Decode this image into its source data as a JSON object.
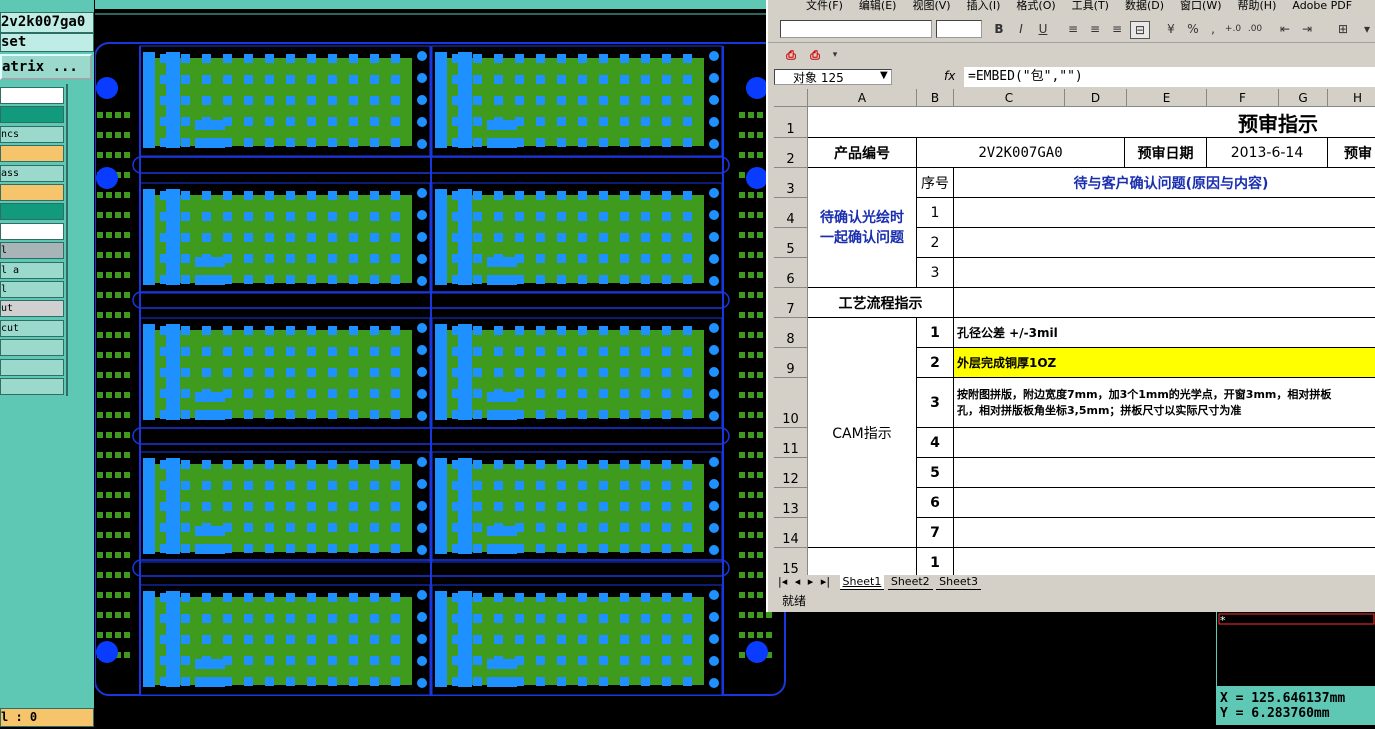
{
  "cam": {
    "job_name": "2v2k007ga0",
    "step_name": "set",
    "matrix_button": "atrix ...",
    "layers": [
      "",
      "",
      "ncs",
      "",
      "ass",
      "",
      "",
      "",
      "l",
      "l a",
      "l",
      "ut",
      "cut",
      "",
      "",
      ""
    ],
    "layer_colors": [
      "#ffffff",
      "#119a7c",
      "#9ad9cc",
      "#f6c46a",
      "#9ad9cc",
      "#f6c46a",
      "#119a7c",
      "#ffffff",
      "#a8b4b8",
      "#9ad9cc",
      "#9ad9cc",
      "#d0d0d0",
      "#9ad9cc",
      "#9ad9cc",
      "#9ad9cc",
      "#9ad9cc"
    ],
    "footer": "l : 0",
    "coord_x": "X = 125.646137mm",
    "coord_y": "Y = 6.283760mm",
    "board_colors": {
      "copper": "#3e9b1e",
      "pad": "#1e90ff",
      "outline": "#1a36e0",
      "hole": "#0a3cff"
    }
  },
  "excel": {
    "menus": [
      "文件(F)",
      "编辑(E)",
      "视图(V)",
      "插入(I)",
      "格式(O)",
      "工具(T)",
      "数据(D)",
      "窗口(W)",
      "帮助(H)",
      "Adobe PDF"
    ],
    "name_box": "对象 125",
    "fx": "fx",
    "formula": "=EMBED(\"包\",\"\")",
    "columns": [
      "A",
      "B",
      "C",
      "D",
      "E",
      "F",
      "G",
      "H"
    ],
    "rows": [
      "1",
      "2",
      "3",
      "4",
      "5",
      "6",
      "7",
      "8",
      "9",
      "10",
      "11",
      "12",
      "13",
      "14",
      "15"
    ],
    "title": "预审指示",
    "product_label": "产品编号",
    "product_value": "2V2K007GA0",
    "date_label": "预审日期",
    "date_value": "2013-6-14",
    "h2_extra": "预审",
    "seq_label": "序号",
    "confirm_header": "待与客户确认问题(原因与内容)",
    "pending_label_1": "待确认光绘时",
    "pending_label_2": "一起确认问题",
    "process_label": "工艺流程指示",
    "cam_label": "CAM指示",
    "num_1": "1",
    "num_2": "2",
    "num_3": "3",
    "num_4": "4",
    "num_5": "5",
    "num_6": "6",
    "num_7": "7",
    "cam_item_1": "孔径公差 +/-3mil",
    "cam_item_2": "外层完成铜厚1OZ",
    "cam_item_3a": "按附图拼版，附边宽度7mm，加3个1mm的光学点，开窗3mm，相对拼板",
    "cam_item_3b": "孔，相对拼版板角坐标3,5mm；拼板尺寸以实际尺寸为准",
    "sheets": [
      "Sheet1",
      "Sheet2",
      "Sheet3"
    ],
    "status": "就绪"
  }
}
